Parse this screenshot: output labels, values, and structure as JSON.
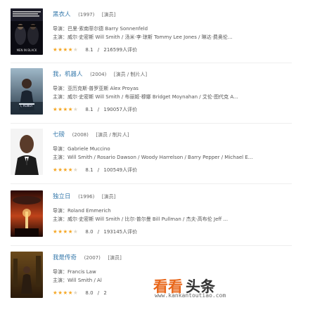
{
  "movies": [
    {
      "title": "黑衣人",
      "year": "(1997)",
      "roles": "[演员]",
      "director_label": "导演：",
      "director": "巴里·索南菲尔德 Barry Sonnenfeld",
      "cast_label": "主演：",
      "cast": "威尔·史密斯 Will Smith / 汤米·李·琼斯 Tommy Lee Jones / 琳达·费奥伦...",
      "stars": 4,
      "score": "8.1",
      "separator": "/",
      "votes": "216599人评价",
      "poster_icon": "men-in-black-poster",
      "poster_text": "MEN IN BLACK"
    },
    {
      "title": "我，机器人",
      "year": "(2004)",
      "roles": "[演员 / 制片人]",
      "director_label": "导演：",
      "director": "亚历克斯·普罗亚斯 Alex Proyas",
      "cast_label": "主演：",
      "cast": "威尔·史密斯 Will Smith / 布丽姬·穆娜 Bridget Moynahan / 艾伦·图代克 A...",
      "stars": 4,
      "score": "8.1",
      "separator": "/",
      "votes": "190057人评价",
      "poster_icon": "i-robot-poster",
      "poster_text": "I, ROBOT"
    },
    {
      "title": "七磅",
      "year": "(2008)",
      "roles": "[演员 / 制片人]",
      "director_label": "导演：",
      "director": "Gabriele Muccino",
      "cast_label": "主演：",
      "cast": "Will Smith / Rosario Dawson / Woody Harrelson / Barry Pepper / Michael E...",
      "stars": 4,
      "score": "8.1",
      "separator": "/",
      "votes": "100549人评价",
      "poster_icon": "seven-pounds-poster",
      "poster_text": ""
    },
    {
      "title": "独立日",
      "year": "(1996)",
      "roles": "[演员]",
      "director_label": "导演：",
      "director": "Roland Emmerich",
      "cast_label": "主演：",
      "cast": "威尔·史密斯 Will Smith / 比尔·普尔曼 Bill Pullman / 杰夫·高布伦 Jeff ...",
      "stars": 4,
      "score": "8.0",
      "separator": "/",
      "votes": "193145人评价",
      "poster_icon": "independence-day-poster",
      "poster_text": ""
    },
    {
      "title": "我是传奇",
      "year": "(2007)",
      "roles": "[演员]",
      "director_label": "导演：",
      "director": "Francis Law",
      "cast_label": "主演：",
      "cast": "Will Smith / Al",
      "stars": 4,
      "score": "8.0",
      "separator": "/",
      "votes": "2",
      "poster_icon": "i-am-legend-poster",
      "poster_text": ""
    }
  ],
  "watermark": {
    "brand_part1": "看看",
    "brand_part2": "头条",
    "url": "www.kankantoutiao.com"
  },
  "colors": {
    "link": "#3377aa",
    "star": "#f5a623",
    "watermark_orange": "#e8671b"
  }
}
